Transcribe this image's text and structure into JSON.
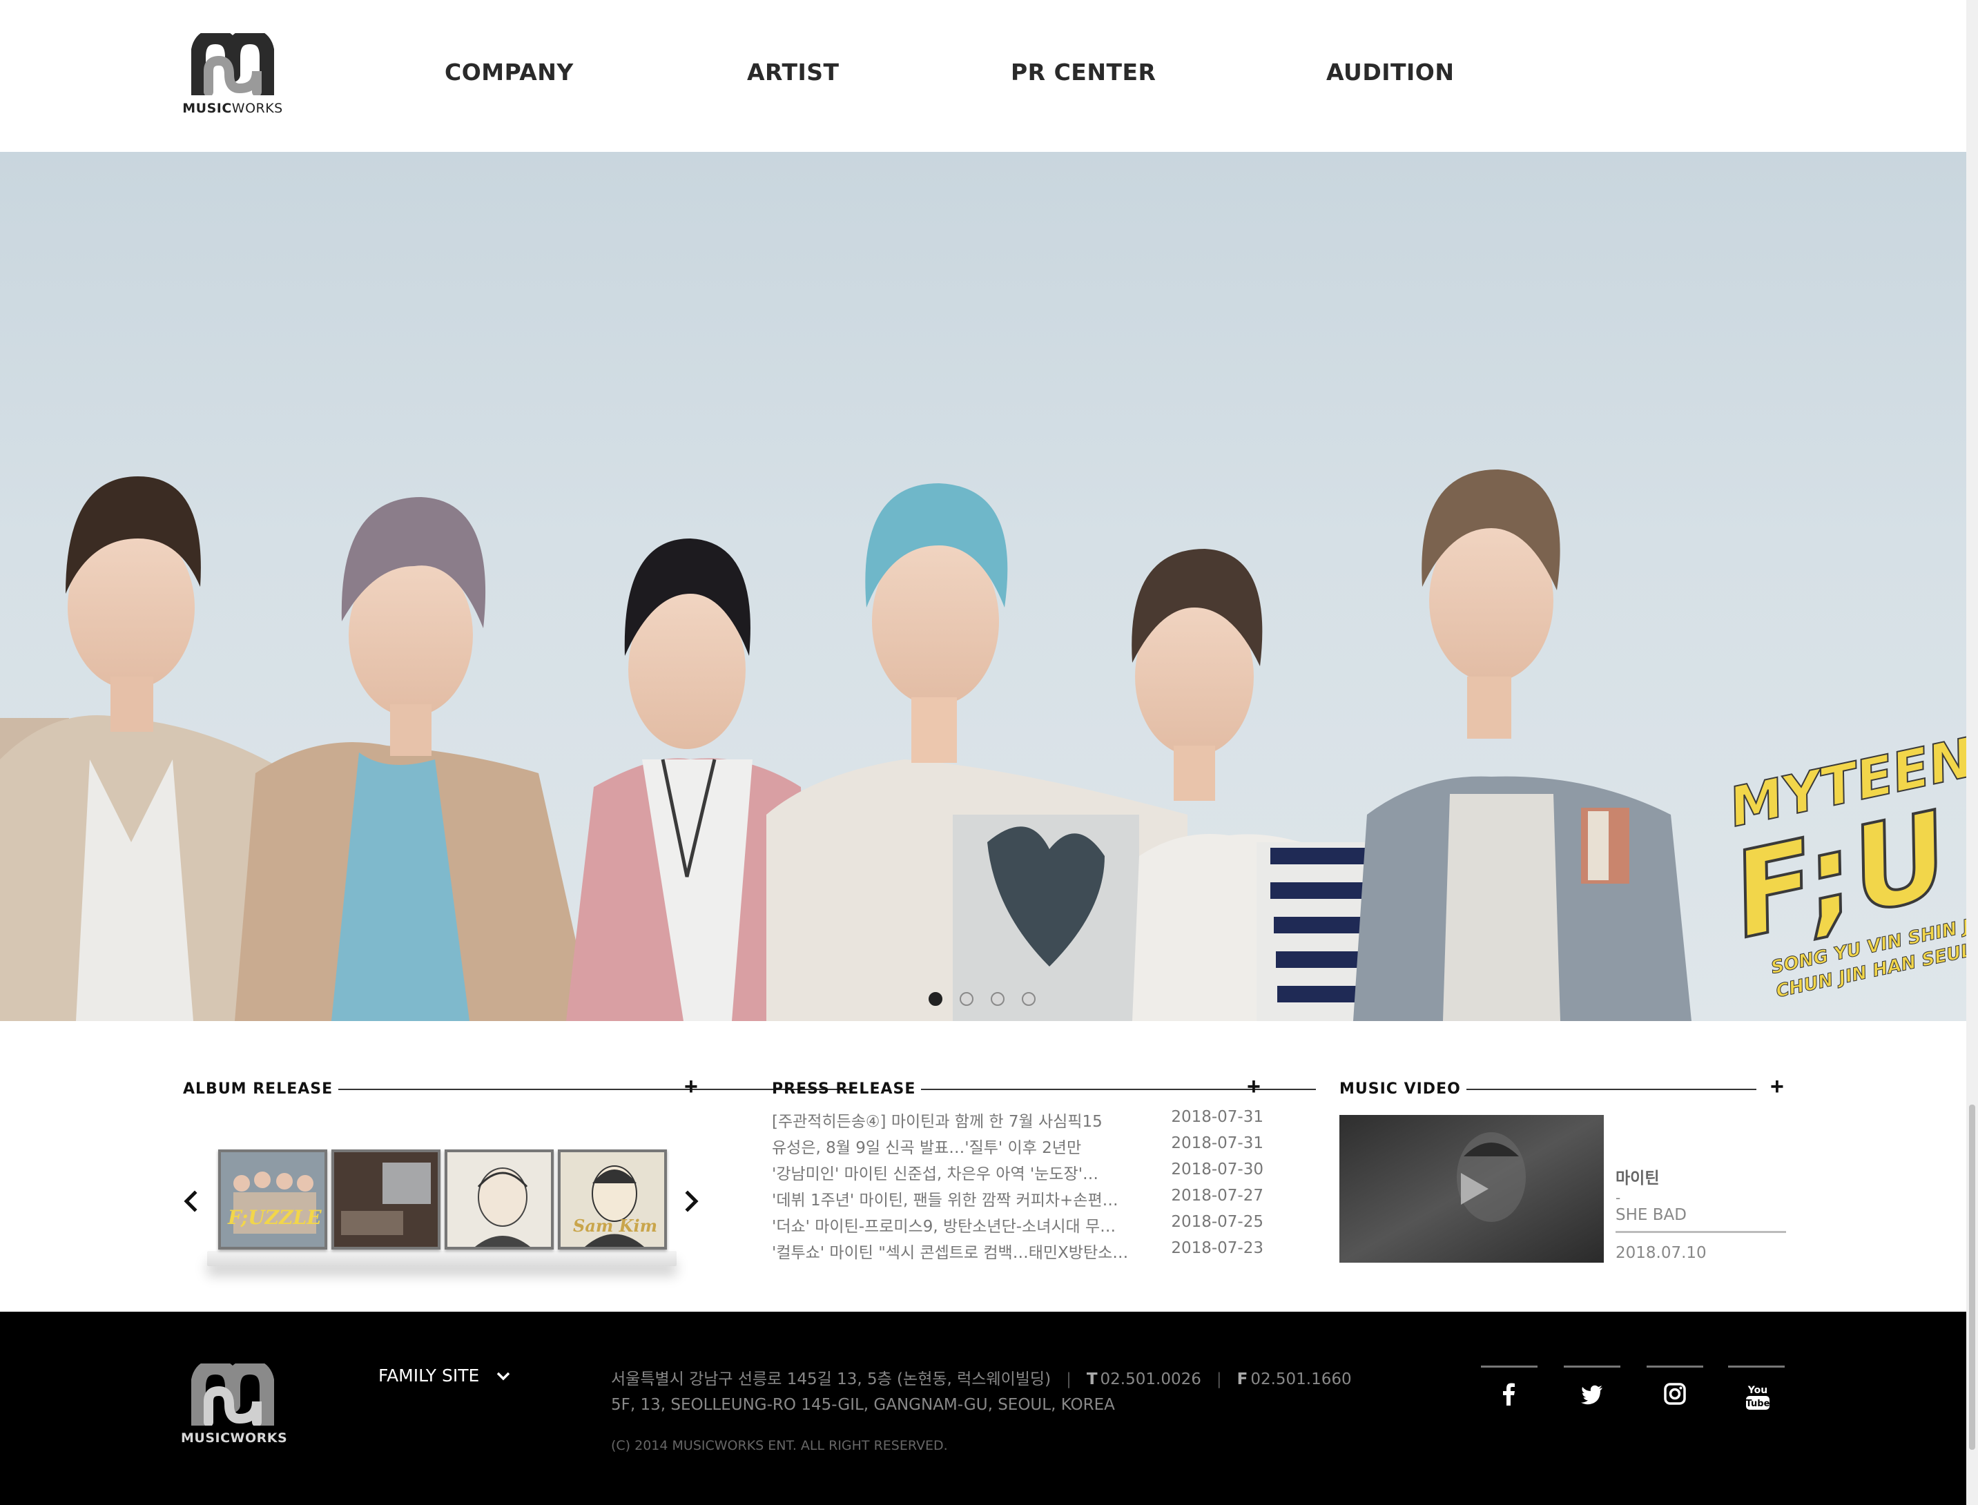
{
  "brand": {
    "logo_word_bold": "MUSIC",
    "logo_word_light": "WORKS"
  },
  "nav": {
    "items": [
      "COMPANY",
      "ARTIST",
      "PR CENTER",
      "AUDITION"
    ]
  },
  "hero": {
    "banner_line1": "MYTEEN",
    "banner_line2": "F;U",
    "banner_names1": "SONG YU VIN   SHIN JU",
    "banner_names2": "CHUN JIN   HAN SEUL",
    "slide_count": 4,
    "active_slide": 1
  },
  "album_release": {
    "title": "ALBUM RELEASE",
    "more": "+",
    "albums": [
      {
        "name": "fuzzle-album",
        "cover_text": "F;UZZLE"
      },
      {
        "name": "room-album",
        "cover_text": ""
      },
      {
        "name": "portrait-album-1",
        "cover_text": ""
      },
      {
        "name": "portrait-album-2",
        "cover_text": "Sam Kim"
      }
    ]
  },
  "press_release": {
    "title": "PRESS RELEASE",
    "more": "+",
    "items": [
      {
        "title": "[주관적히든송④] 마이틴과 함께 한 7월 사심픽15",
        "date": "2018-07-31"
      },
      {
        "title": "유성은, 8월 9일 신곡 발표…'질투' 이후 2년만",
        "date": "2018-07-31"
      },
      {
        "title": "'강남미인' 마이틴 신준섭, 차은우 아역 '눈도장'…",
        "date": "2018-07-30"
      },
      {
        "title": "'데뷔 1주년' 마이틴, 팬들 위한 깜짝 커피차+손편…",
        "date": "2018-07-27"
      },
      {
        "title": "'더쇼' 마이틴-프로미스9, 방탄소년단-소녀시대 무…",
        "date": "2018-07-25"
      },
      {
        "title": "'컬투쇼' 마이틴 \"섹시 콘셉트로 컴백…태민X방탄소…",
        "date": "2018-07-23"
      }
    ]
  },
  "music_video": {
    "title": "MUSIC VIDEO",
    "more": "+",
    "artist": "마이틴",
    "dash": "-",
    "song": "SHE BAD",
    "date": "2018.07.10"
  },
  "footer": {
    "family_site": "FAMILY SITE",
    "address_kr": "서울특별시 강남구 선릉로 145길 13, 5층 (논현동, 럭스웨이빌딩)",
    "tel_label": "T",
    "tel": "02.501.0026",
    "fax_label": "F",
    "fax": "02.501.1660",
    "address_en": "5F, 13, SEOLLEUNG-RO 145-GIL, GANGNAM-GU, SEOUL, KOREA",
    "copyright": "(C) 2014 MUSICWORKS ENT. ALL RIGHT RESERVED.",
    "social": [
      "facebook-icon",
      "twitter-icon",
      "instagram-icon",
      "youtube-icon"
    ],
    "youtube_text_1": "You",
    "youtube_text_2": "Tube"
  },
  "colors": {
    "accent_text": "#2a2a2a",
    "footer_bg": "#000000",
    "banner_yellow": "#f2d64a"
  }
}
